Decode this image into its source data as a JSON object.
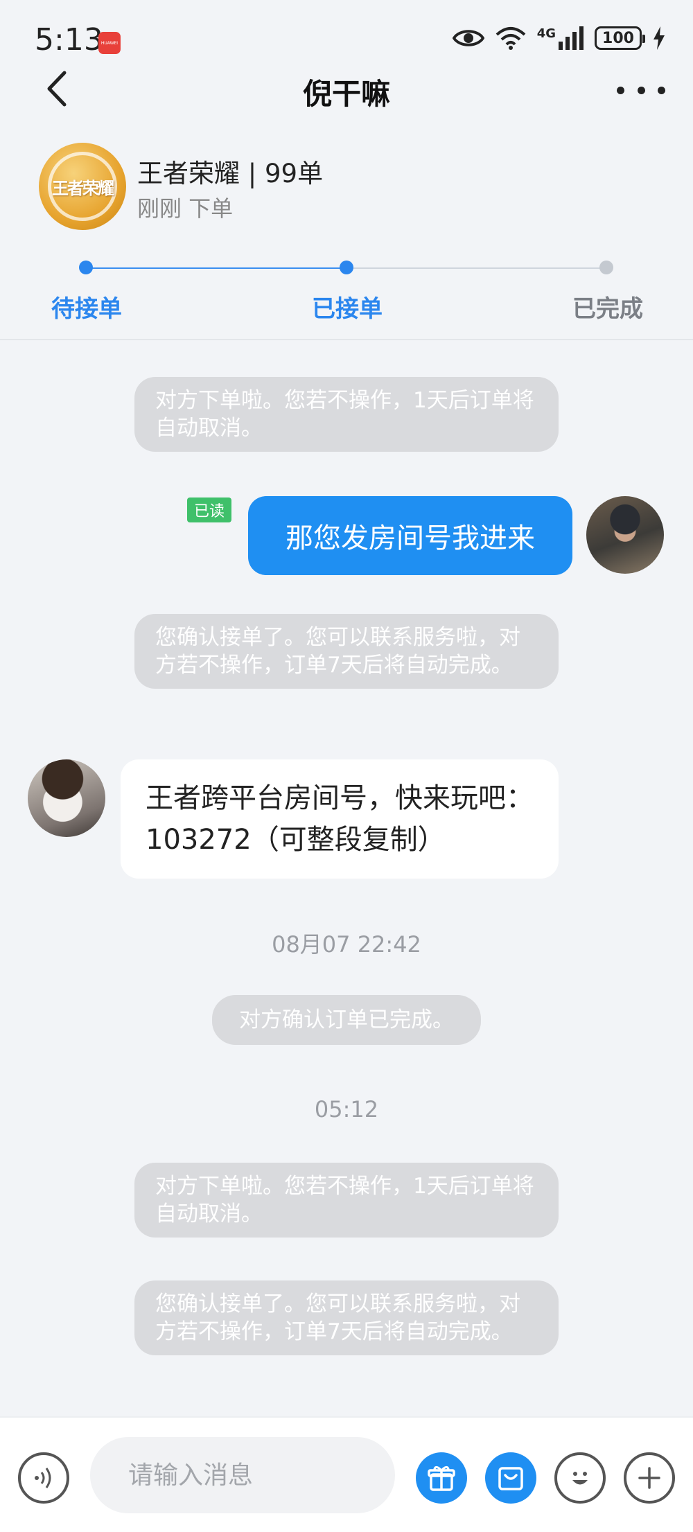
{
  "status_bar": {
    "time": "5:13",
    "badge_text": "HUAWEI",
    "network": "4G",
    "battery": "100"
  },
  "nav": {
    "title": "倪干嘛"
  },
  "order": {
    "title": "王者荣耀 | 99单",
    "subtitle": "刚刚 下单",
    "logo_text": "王者荣耀",
    "steps": [
      {
        "label": "待接单",
        "state": "done"
      },
      {
        "label": "已接单",
        "state": "current"
      },
      {
        "label": "已完成",
        "state": "pending"
      }
    ]
  },
  "chat": {
    "sys1": "对方下单啦。您若不操作，1天后订单将自动取消。",
    "read_badge": "已读",
    "me_msg": "那您发房间号我进来",
    "sys2": "您确认接单了。您可以联系服务啦，对方若不操作，订单7天后将自动完成。",
    "them_msg": "王者跨平台房间号，快来玩吧：103272（可整段复制）",
    "time1": "08月07 22:42",
    "sys3": "对方确认订单已完成。",
    "time2": "05:12",
    "sys4": "对方下单啦。您若不操作，1天后订单将自动取消。",
    "sys5": "您确认接单了。您可以联系服务啦，对方若不操作，订单7天后将自动完成。"
  },
  "input": {
    "placeholder": "请输入消息"
  },
  "colors": {
    "accent": "#1f8ff2",
    "read_badge": "#3fc06a",
    "system_bubble": "#d9dadd"
  }
}
